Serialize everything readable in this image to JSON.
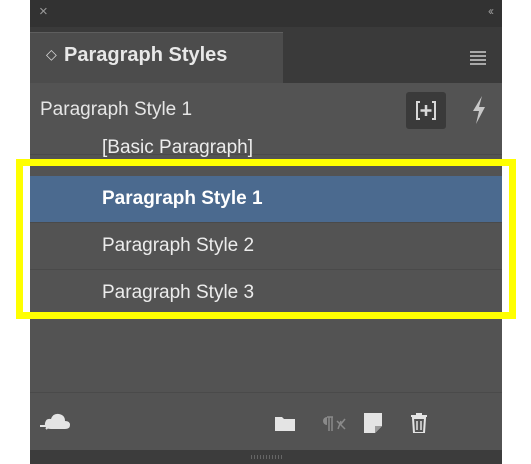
{
  "window": {
    "close_glyph": "×",
    "collapse_glyph": "‹‹"
  },
  "tab": {
    "label": "Paragraph Styles",
    "chevron_glyph": "◇"
  },
  "current_style": {
    "label": "Paragraph Style 1"
  },
  "styles_list": [
    {
      "label": "[Basic Paragraph]",
      "selected": false
    },
    {
      "label": "Paragraph Style 1",
      "selected": true
    },
    {
      "label": "Paragraph Style 2",
      "selected": false
    },
    {
      "label": "Paragraph Style 3",
      "selected": false
    }
  ],
  "icons": {
    "close": "close-icon",
    "collapse": "collapse-icon",
    "panel_menu": "panel-menu-icon",
    "new_from_selection": "new-style-from-selection-icon",
    "lightning": "quick-apply-icon",
    "cloud": "cc-libraries-cloud-icon",
    "folder": "new-style-group-icon",
    "clear_overrides": "clear-overrides-icon",
    "new_style": "new-style-icon",
    "trash": "delete-style-icon"
  },
  "colors": {
    "panel_bg": "#535353",
    "title_bg": "#323232",
    "selected_row": "#4b6a8f",
    "highlight": "#ffff00"
  }
}
